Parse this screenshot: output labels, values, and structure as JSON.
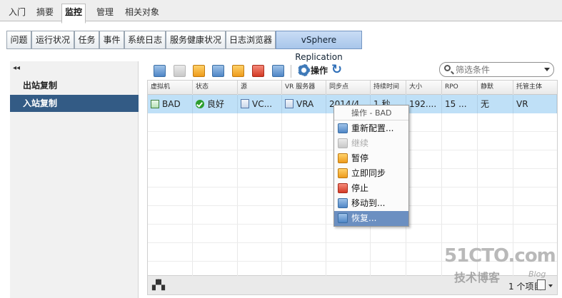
{
  "top_tabs": [
    "入门",
    "摘要",
    "监控",
    "管理",
    "相关对象"
  ],
  "sub_tabs": [
    "问题",
    "运行状况",
    "任务",
    "事件",
    "系统日志",
    "服务健康状况",
    "日志浏览器",
    "vSphere Replication"
  ],
  "left_nav": {
    "collapse_glyph": "◂◂",
    "items": [
      "出站复制",
      "入站复制"
    ],
    "selected": "入站复制"
  },
  "toolbar": {
    "actions_label": "操作",
    "filter_placeholder": "筛选条件"
  },
  "table": {
    "columns": [
      "虚拟机",
      "状态",
      "源",
      "VR 服务器",
      "同步点",
      "持续时间",
      "大小",
      "RPO",
      "静默",
      "托管主体"
    ],
    "rows": [
      [
        "BAD",
        "良好",
        "VC...",
        "VRA",
        "2014/4...",
        "1 秒",
        "192....",
        "15 ...",
        "无",
        "VR"
      ]
    ]
  },
  "context_menu": {
    "title": "操作 - BAD",
    "items": [
      {
        "label": "重新配置...",
        "enabled": true
      },
      {
        "label": "继续",
        "enabled": false
      },
      {
        "label": "暂停",
        "enabled": true
      },
      {
        "label": "立即同步",
        "enabled": true
      },
      {
        "label": "停止",
        "enabled": true
      },
      {
        "label": "移动到...",
        "enabled": true
      },
      {
        "label": "恢复...",
        "enabled": true,
        "highlighted": true
      }
    ]
  },
  "footer": {
    "count_text": "1 个项目"
  },
  "watermark": {
    "main": "51CTO.com",
    "sub": "技术博客",
    "blog": "Blog"
  },
  "colors": {
    "selected_nav": "#335b85",
    "selected_row": "#bfe0f7",
    "menu_highlight": "#6b8fc1",
    "active_subtab": "#a8c6ea"
  }
}
